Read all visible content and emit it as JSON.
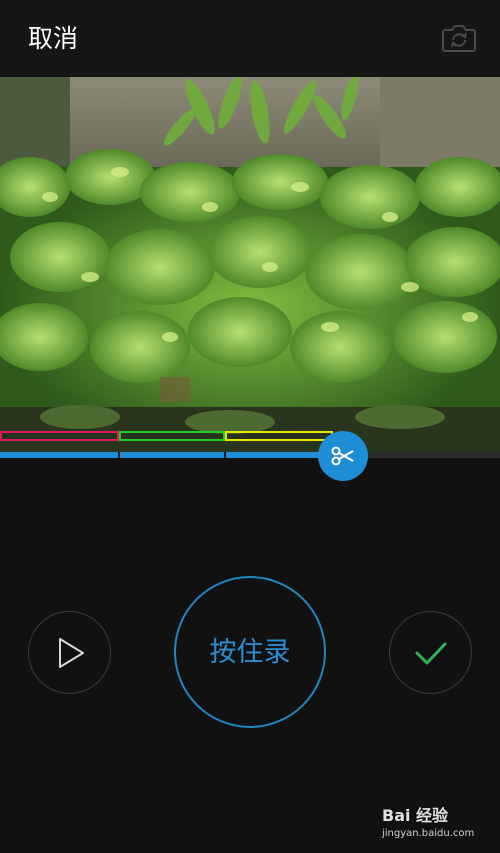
{
  "topbar": {
    "cancel_label": "取消",
    "camera_switch_icon": "camera-switch-icon"
  },
  "viewfinder": {
    "content": "camera-preview"
  },
  "segments": [
    {
      "color": "#e0185c"
    },
    {
      "color": "#22cc22"
    },
    {
      "color": "#e6e600"
    }
  ],
  "progress": {
    "fill_color": "#1e8fd6",
    "recorded_fraction": 0.68
  },
  "controls": {
    "play_icon": "play-icon",
    "record_label": "按住录",
    "confirm_icon": "checkmark-icon",
    "cut_icon": "scissors-icon"
  },
  "watermark": {
    "brand": "Bai 经验",
    "url": "jingyan.baidu.com"
  }
}
